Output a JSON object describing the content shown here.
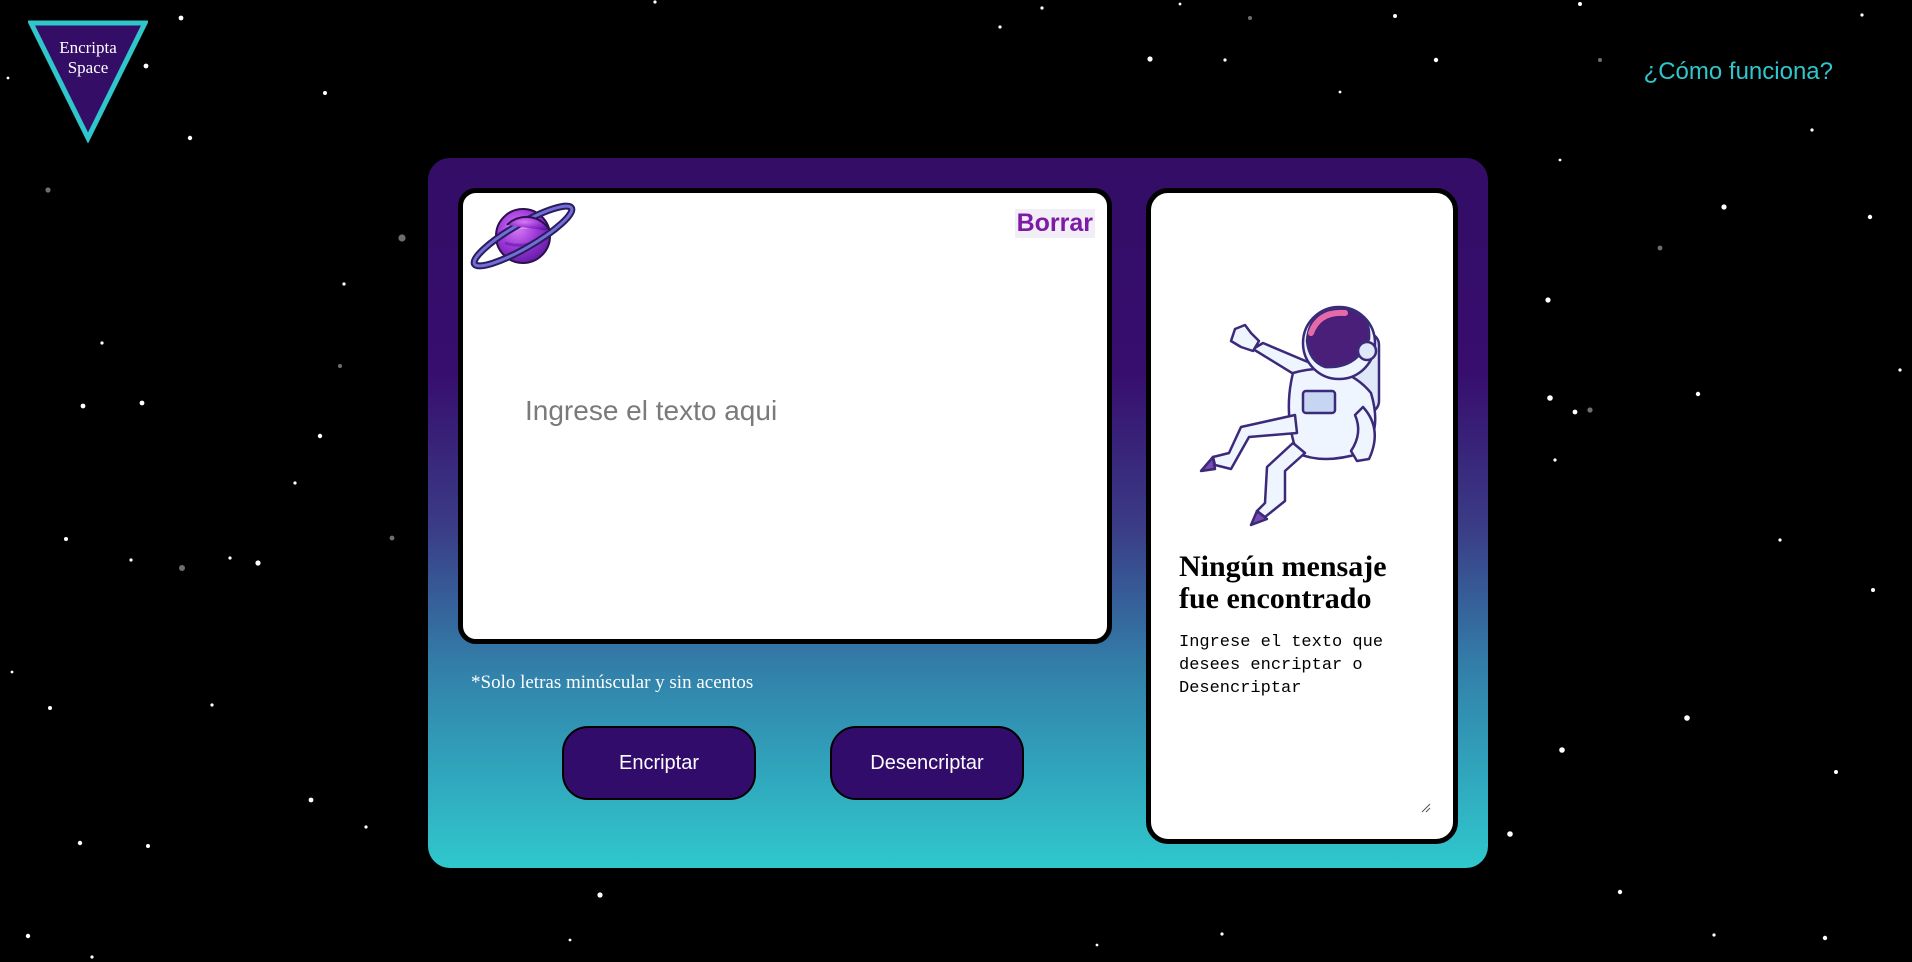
{
  "header": {
    "logo_line1": "Encripta",
    "logo_line2": "Space",
    "help_link": "¿Cómo funciona?"
  },
  "input_card": {
    "clear_label": "Borrar",
    "placeholder": "Ingrese el texto aqui",
    "value": ""
  },
  "hint": "*Solo letras minúscular y sin acentos",
  "actions": {
    "encrypt_label": "Encriptar",
    "decrypt_label": "Desencriptar"
  },
  "output_card": {
    "title": "Ningún mensaje fue encontrado",
    "description": "Ingrese el texto que desees encriptar o Desencriptar"
  },
  "colors": {
    "accent_cyan": "#2fc6cc",
    "panel_purple": "#330d66",
    "button_purple": "#320c6a",
    "clear_purple": "#7d1aa6"
  },
  "icons": [
    "planet-icon",
    "astronaut-illustration",
    "logo-triangle"
  ]
}
